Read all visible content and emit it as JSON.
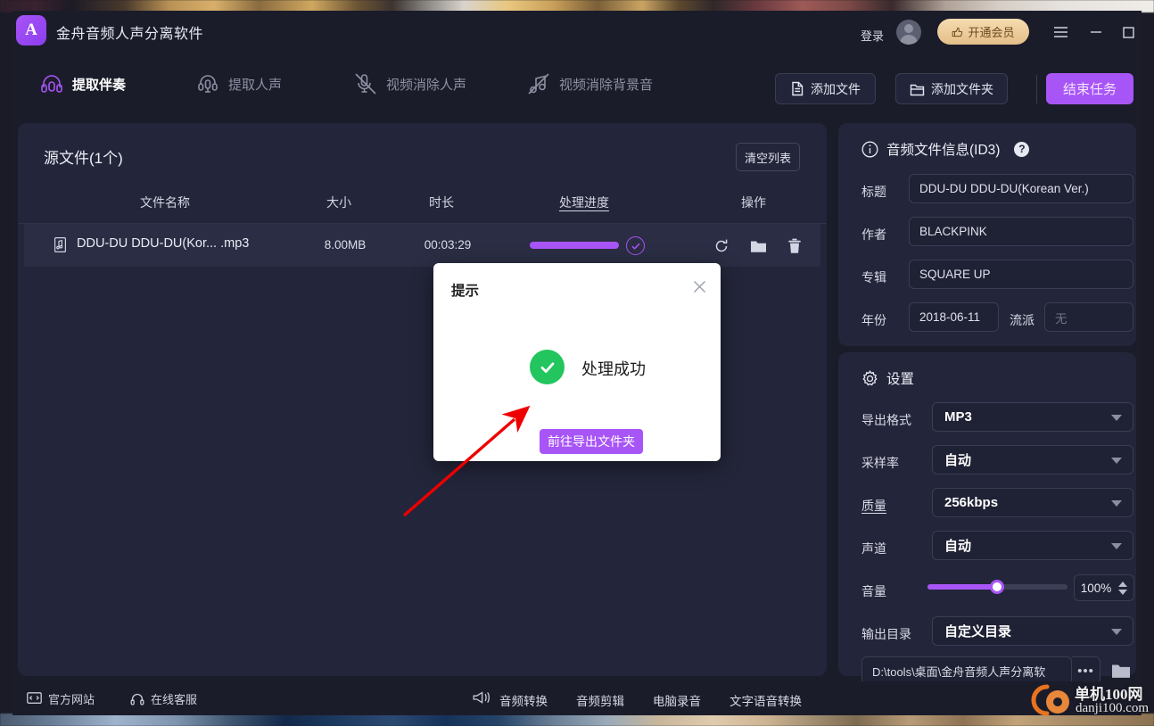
{
  "window": {
    "title": "金舟音频人声分离软件",
    "logo_glyph": "A",
    "login_label": "登录",
    "vip_label": "开通会员",
    "menu_icon": "hamburger-menu-icon",
    "minimize_icon": "minimize-icon",
    "maximize_icon": "maximize-icon",
    "close_icon": "close-icon",
    "accent": "#a855f7",
    "vip_gold": "#e4bf89"
  },
  "tabs": [
    {
      "label": "提取伴奏",
      "icon": "headphones-icon",
      "active": true
    },
    {
      "label": "提取人声",
      "icon": "microphone-icon",
      "active": false
    },
    {
      "label": "视频消除人声",
      "icon": "mic-slash-icon",
      "active": false
    },
    {
      "label": "视频消除背景音",
      "icon": "music-note-slash-icon",
      "active": false
    }
  ],
  "header_actions": {
    "add_file": "添加文件",
    "add_folder": "添加文件夹",
    "end_task": "结束任务"
  },
  "source_list": {
    "title": "源文件(1个)",
    "clear_label": "清空列表",
    "columns": [
      "文件名称",
      "大小",
      "时长",
      "处理进度",
      "操作"
    ],
    "rows": [
      {
        "name": "DDU-DU DDU-DU(Kor... .mp3",
        "size": "8.00MB",
        "duration": "00:03:29",
        "progress": 100,
        "actions": [
          "refresh-icon",
          "folder-icon",
          "trash-icon"
        ]
      }
    ]
  },
  "id3": {
    "panel_title": "音频文件信息(ID3)",
    "help_label": "?",
    "fields": [
      {
        "label": "标题",
        "value": "DDU-DU DDU-DU(Korean Ver.)"
      },
      {
        "label": "作者",
        "value": "BLACKPINK"
      },
      {
        "label": "专辑",
        "value": "SQUARE UP"
      }
    ],
    "year_label": "年份",
    "year_value": "2018-06-11",
    "genre_label": "流派",
    "genre_placeholder": "无"
  },
  "settings": {
    "panel_title": "设置",
    "format_label": "导出格式",
    "format_value": "MP3",
    "samplerate_label": "采样率",
    "samplerate_value": "自动",
    "quality_label": "质量",
    "quality_value": "256kbps",
    "channel_label": "声道",
    "channel_value": "自动",
    "volume_label": "音量",
    "volume_value": "100%",
    "volume_percent": 48,
    "outdir_label": "输出目录",
    "outdir_value": "自定义目录",
    "path_value": "D:\\tools\\桌面\\金舟音频人声分离软",
    "dots_label": "•••"
  },
  "modal": {
    "title": "提示",
    "message": "处理成功",
    "button_label": "前往导出文件夹",
    "success_color": "#22c55e",
    "close_icon": "close-icon"
  },
  "bottom_bar": {
    "website": "官方网站",
    "support": "在线客服",
    "tools": [
      "音频转换",
      "音频剪辑",
      "电脑录音",
      "文字语音转换"
    ]
  },
  "watermark": {
    "line1": "单机100网",
    "line2": "danji100.com"
  }
}
